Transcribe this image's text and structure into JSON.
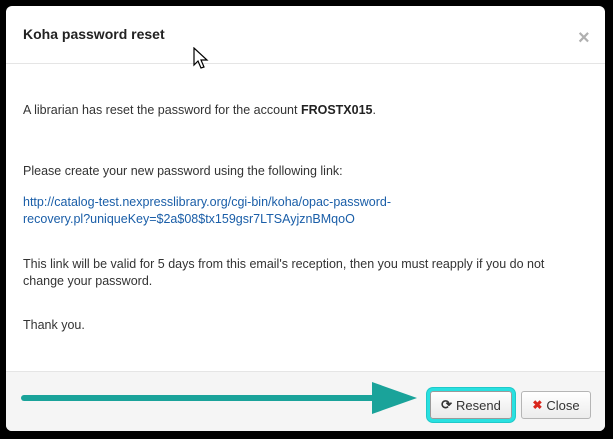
{
  "modal": {
    "title": "Koha password reset",
    "close_glyph": "×"
  },
  "message": {
    "line1_prefix": "A librarian has reset the password for the account ",
    "account": "FROSTX015",
    "line1_suffix": ".",
    "line2": "Please create your new password using the following link:",
    "link_line1": "http://catalog-test.nexpresslibrary.org/cgi-bin/koha/opac-password-",
    "link_line2": "recovery.pl?uniqueKey=$2a$08$tx159gsr7LTSAyjznBMqoO",
    "validity_line1": "This link will be valid for 5 days from this email's reception, then you must reapply if you do not",
    "validity_line2": "change your password.",
    "signoff": "Thank you."
  },
  "footer": {
    "resend_label": "Resend",
    "close_label": "Close",
    "resend_icon": "refresh-icon",
    "close_icon": "times-icon"
  },
  "colors": {
    "highlight": "#29e0e0",
    "arrow": "#1aa39a",
    "link": "#1a5ea8"
  }
}
